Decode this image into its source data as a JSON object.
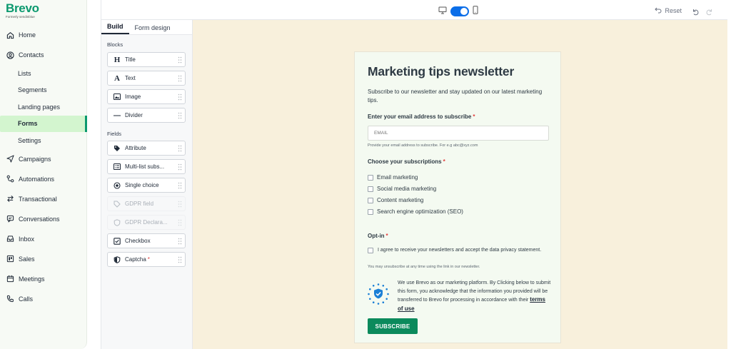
{
  "brand": {
    "name": "Brevo",
    "subtitle": "Formerly sendinblue",
    "color": "#0b996e"
  },
  "nav": {
    "items": [
      {
        "label": "Home",
        "icon": "home-icon"
      },
      {
        "label": "Contacts",
        "icon": "contacts-icon"
      },
      {
        "label": "Lists",
        "sub": true
      },
      {
        "label": "Segments",
        "sub": true
      },
      {
        "label": "Landing pages",
        "sub": true
      },
      {
        "label": "Forms",
        "sub": true,
        "active": true
      },
      {
        "label": "Settings",
        "sub": true
      },
      {
        "label": "Campaigns",
        "icon": "send-icon"
      },
      {
        "label": "Automations",
        "icon": "automation-icon"
      },
      {
        "label": "Transactional",
        "icon": "transactional-icon"
      },
      {
        "label": "Conversations",
        "icon": "chat-icon"
      },
      {
        "label": "Inbox",
        "icon": "inbox-icon"
      },
      {
        "label": "Sales",
        "icon": "sales-icon"
      },
      {
        "label": "Meetings",
        "icon": "calendar-icon"
      },
      {
        "label": "Calls",
        "icon": "phone-icon"
      }
    ]
  },
  "toolbar": {
    "reset_label": "Reset",
    "toggle_color": "#0b6ee8"
  },
  "panel": {
    "tabs": [
      {
        "label": "Build",
        "active": true
      },
      {
        "label": "Form design"
      }
    ],
    "blocks_title": "Blocks",
    "blocks": [
      {
        "label": "Title",
        "icon": "title-icon"
      },
      {
        "label": "Text",
        "icon": "text-icon"
      },
      {
        "label": "Image",
        "icon": "image-icon"
      },
      {
        "label": "Divider",
        "icon": "divider-icon"
      }
    ],
    "fields_title": "Fields",
    "fields": [
      {
        "label": "Attribute",
        "icon": "tag-icon"
      },
      {
        "label": "Multi-list subs...",
        "icon": "list-icon"
      },
      {
        "label": "Single choice",
        "icon": "radio-icon"
      },
      {
        "label": "GDPR field",
        "icon": "gdpr-icon",
        "disabled": true
      },
      {
        "label": "GDPR Declara...",
        "icon": "shield-icon",
        "disabled": true
      },
      {
        "label": "Checkbox",
        "icon": "checkbox-icon"
      },
      {
        "label": "Captcha",
        "icon": "captcha-icon",
        "required": "*"
      }
    ]
  },
  "form": {
    "title": "Marketing tips newsletter",
    "description": "Subscribe to our newsletter and stay updated on our latest marketing tips.",
    "email_label": "Enter your email address to subscribe",
    "required_mark": "*",
    "email_placeholder": "EMAIL",
    "email_help": "Provide your email address to subscribe. For e.g abc@xyz.com",
    "subscriptions_label": "Choose your subscriptions",
    "subscriptions": [
      "Email marketing",
      "Social media marketing",
      "Content marketing",
      "Search engine optimization (SEO)"
    ],
    "optin_label": "Opt-in",
    "optin_text": "I agree to receive your newsletters and accept the data privacy statement.",
    "optin_help": "You may unsubscribe at any time using the link in our newsletter.",
    "legal_text": "We use Brevo as our marketing platform. By Clicking below to submit this form, you acknowledge that the information you provided will be transferred to Brevo for processing in accordance with their ",
    "legal_link": "terms of use",
    "submit_label": "SUBSCRIBE",
    "button_color": "#0b8a5c",
    "canvas_color": "#f8f0dc"
  }
}
